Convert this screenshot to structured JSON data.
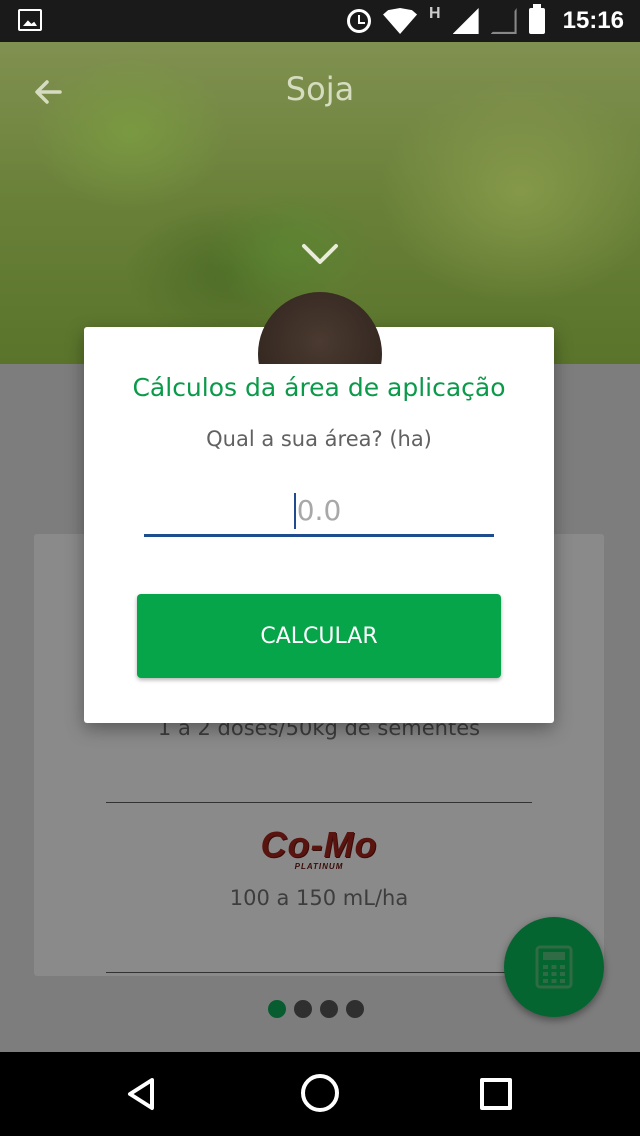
{
  "status_bar": {
    "network_label": "H",
    "time": "15:16",
    "icons": [
      "gallery-icon",
      "alarm-icon",
      "wifi-icon",
      "signal-icon",
      "signal-empty-icon",
      "battery-icon"
    ]
  },
  "header": {
    "title": "Soja",
    "back_icon": "arrow-left-icon",
    "expand_icon": "chevron-down-icon"
  },
  "card": {
    "dose_text": "1 a 2 doses/50kg de sementes",
    "product_logo": {
      "brand": "Co-Mo",
      "sub": "PLATINUM"
    },
    "rate_text": "100 a 150 mL/ha"
  },
  "pager": {
    "pages": 4,
    "current": 1
  },
  "fab": {
    "icon": "calculator-icon"
  },
  "dialog": {
    "title": "Cálculos da área de aplicação",
    "question": "Qual a sua área? (ha)",
    "input_value": "",
    "input_placeholder": "0.0",
    "button_label": "CALCULAR"
  },
  "colors": {
    "accent_green": "#06a54a",
    "title_green": "#0b9a4a",
    "input_underline": "#1e4c8c",
    "fab_green": "#056530"
  },
  "nav_bar": {
    "icons": [
      "nav-back-icon",
      "nav-home-icon",
      "nav-recents-icon"
    ]
  }
}
